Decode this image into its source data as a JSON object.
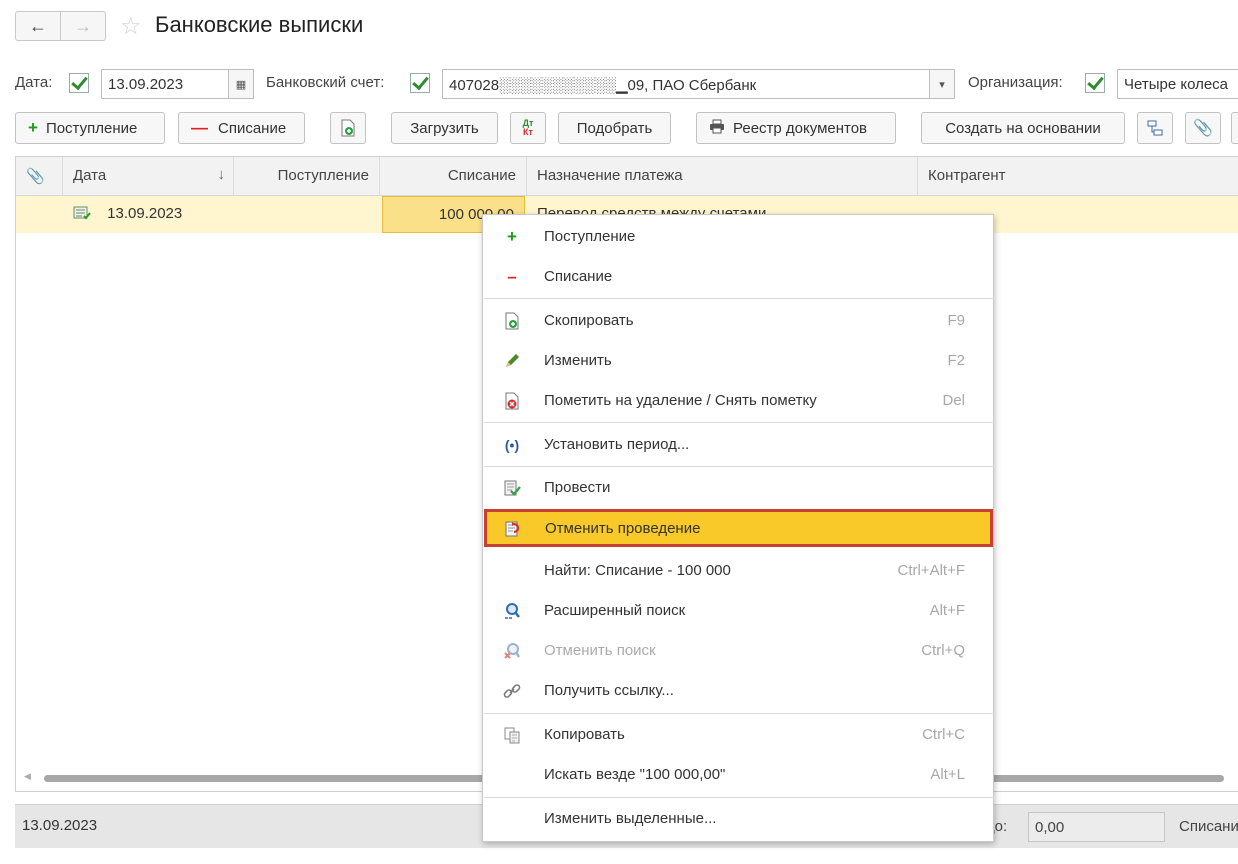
{
  "window": {
    "title": "Банковские выписки"
  },
  "filters": {
    "date_label": "Дата:",
    "date_value": "13.09.2023",
    "account_label": "Банковский счет:",
    "account_value": "407028░░░░░░░░░░░▁09, ПАО Сбербанк",
    "org_label": "Организация:",
    "org_value": "Четыре колеса"
  },
  "toolbar": {
    "receipt": "Поступление",
    "writeoff": "Списание",
    "load": "Загрузить",
    "dtkt": "Дт Кт",
    "pick": "Подобрать",
    "registry": "Реестр документов",
    "create_based": "Создать на основании"
  },
  "table": {
    "columns": [
      "Дата",
      "Поступление",
      "Списание",
      "Назначение платежа",
      "Контрагент"
    ],
    "rows": [
      {
        "date": "13.09.2023",
        "receipt": "",
        "writeoff": "100 000,00",
        "purpose": "Перевод средств между счетами",
        "counterparty": ""
      }
    ]
  },
  "footer": {
    "date": "13.09.2023",
    "balance_label": "Сальдо:",
    "balance_value": "0,00",
    "writeoff_label": "Списание"
  },
  "context_menu": {
    "items": [
      {
        "label": "Поступление",
        "shortcut": ""
      },
      {
        "label": "Списание",
        "shortcut": ""
      },
      {
        "label": "Скопировать",
        "shortcut": "F9"
      },
      {
        "label": "Изменить",
        "shortcut": "F2"
      },
      {
        "label": "Пометить на удаление / Снять пометку",
        "shortcut": "Del"
      },
      {
        "label": "Установить период...",
        "shortcut": ""
      },
      {
        "label": "Провести",
        "shortcut": ""
      },
      {
        "label": "Отменить проведение",
        "shortcut": ""
      },
      {
        "label": "Найти: Списание - 100 000",
        "shortcut": "Ctrl+Alt+F"
      },
      {
        "label": "Расширенный поиск",
        "shortcut": "Alt+F"
      },
      {
        "label": "Отменить поиск",
        "shortcut": "Ctrl+Q"
      },
      {
        "label": "Получить ссылку...",
        "shortcut": ""
      },
      {
        "label": "Копировать",
        "shortcut": "Ctrl+C"
      },
      {
        "label": "Искать везде \"100 000,00\"",
        "shortcut": "Alt+L"
      },
      {
        "label": "Изменить выделенные...",
        "shortcut": ""
      }
    ]
  },
  "colors": {
    "highlight": "#f8c928",
    "highlight_border": "#c8412e",
    "row_selected": "#fff6cf"
  }
}
